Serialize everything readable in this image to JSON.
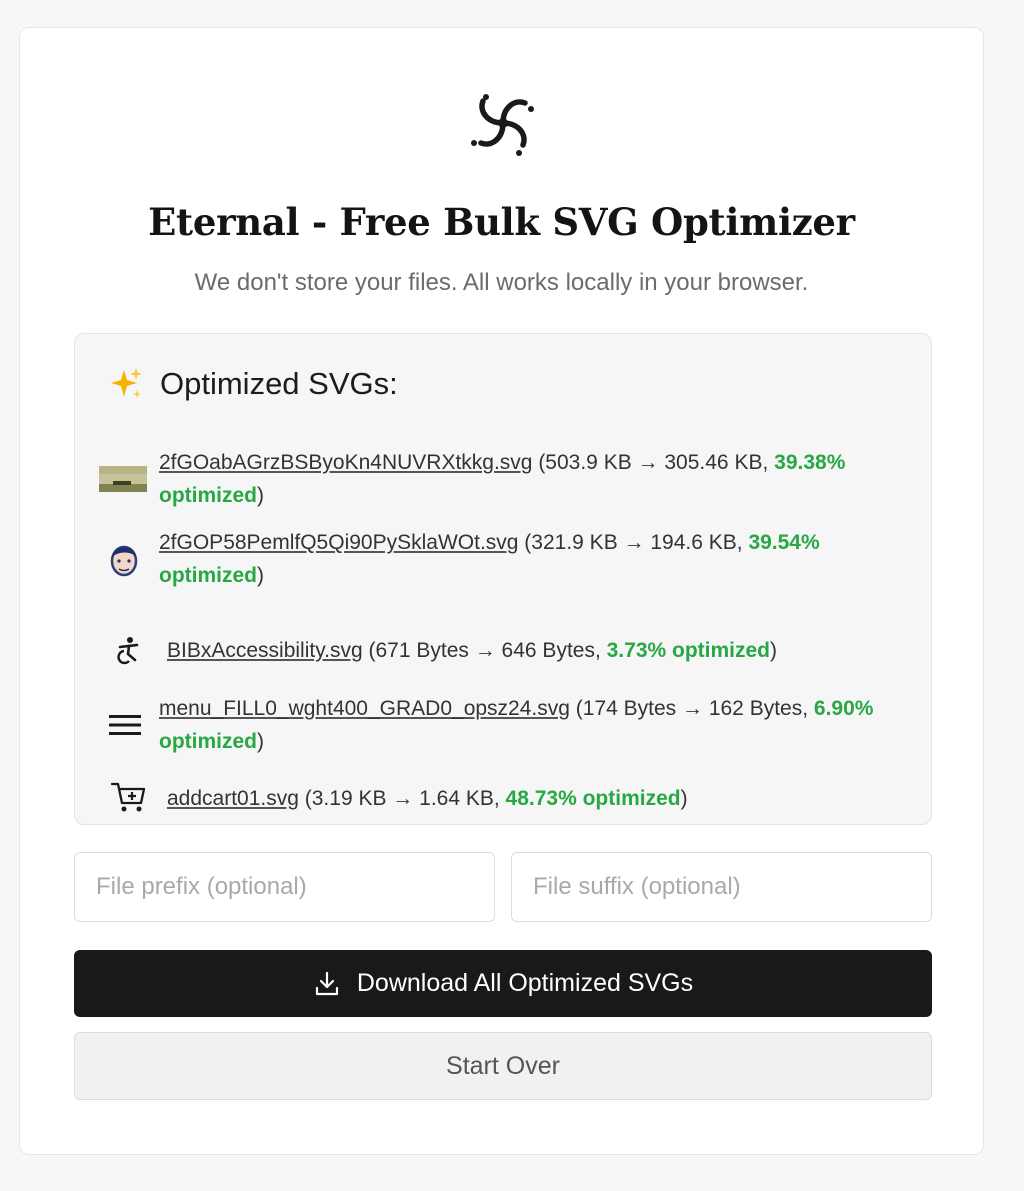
{
  "app": {
    "title": "Eternal - Free Bulk SVG Optimizer",
    "subtitle": "We don't store your files. All works locally in your browser.",
    "logo_icon": "swirl-logo-icon"
  },
  "results": {
    "heading": "Optimized SVGs:",
    "heading_icon": "sparkles-icon",
    "files": [
      {
        "name": "2fGOabAGrzBSByoKn4NUVRXtkkg.svg",
        "stats_prefix": " (503.9 KB → 305.46 KB, ",
        "percent": "39.38% optimized",
        "stats_suffix": ")",
        "thumb_icon": "landscape-thumbnail-icon"
      },
      {
        "name": "2fGOP58PemlfQ5Qi90PySklaWOt.svg",
        "stats_prefix": " (321.9 KB → 194.6 KB, ",
        "percent": "39.54% optimized",
        "stats_suffix": ")",
        "thumb_icon": "face-thumbnail-icon"
      },
      {
        "name": "BIBxAccessibility.svg",
        "stats_prefix": " (671 Bytes → 646 Bytes, ",
        "percent": "3.73% optimized",
        "stats_suffix": ")",
        "thumb_icon": "accessibility-icon"
      },
      {
        "name": "menu_FILL0_wght400_GRAD0_opsz24.svg",
        "stats_prefix": " (174 Bytes → 162 Bytes, ",
        "percent": "6.90% optimized",
        "stats_suffix": ")",
        "thumb_icon": "menu-icon"
      },
      {
        "name": "addcart01.svg",
        "stats_prefix": " (3.19 KB → 1.64 KB, ",
        "percent": "48.73% optimized",
        "stats_suffix": ")",
        "thumb_icon": "add-cart-icon"
      }
    ]
  },
  "inputs": {
    "prefix_placeholder": "File prefix (optional)",
    "prefix_value": "",
    "suffix_placeholder": "File suffix (optional)",
    "suffix_value": ""
  },
  "actions": {
    "download_label": "Download All Optimized SVGs",
    "download_icon": "download-icon",
    "start_over_label": "Start Over"
  },
  "colors": {
    "accent_green": "#28a745",
    "primary_button": "#19191b",
    "subtitle_gray": "#6b6b6b"
  }
}
